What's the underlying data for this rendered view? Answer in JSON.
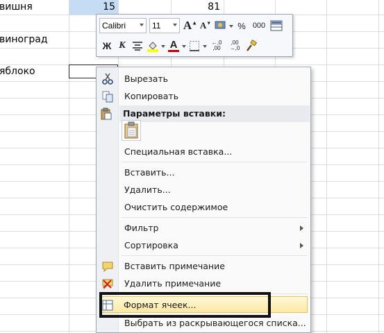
{
  "sheet": {
    "cells": [
      {
        "text": "вишня",
        "col": "A"
      },
      {
        "text": "виноград",
        "col": "A"
      },
      {
        "text": "яблоко",
        "col": "A"
      }
    ],
    "row1_b_value": "15",
    "row1_c_value": "81"
  },
  "mini_toolbar": {
    "font_name": "Calibri",
    "font_size": "11",
    "bold_label": "Ж",
    "italic_label": "К",
    "percent_label": "%",
    "thousands_label": "000",
    "dec_increase_label": "+,0\n,00",
    "dec_decrease_label": ",00\n→,0",
    "font_color": "#c00000",
    "fill_color": "#ffff00"
  },
  "context_menu": {
    "items": [
      {
        "label": "Вырезать",
        "icon": "scissors-icon"
      },
      {
        "label": "Копировать",
        "icon": "copy-icon"
      },
      {
        "label": "Параметры вставки:",
        "icon": "paste-options-icon"
      },
      {
        "label": "Специальная вставка...",
        "icon": ""
      },
      {
        "label": "Вставить...",
        "icon": ""
      },
      {
        "label": "Удалить...",
        "icon": ""
      },
      {
        "label": "Очистить содержимое",
        "icon": ""
      },
      {
        "label": "Фильтр",
        "icon": "",
        "submenu": true
      },
      {
        "label": "Сортировка",
        "icon": "",
        "submenu": true
      },
      {
        "label": "Вставить примечание",
        "icon": "insert-comment-icon"
      },
      {
        "label": "Удалить примечание",
        "icon": "delete-comment-icon"
      },
      {
        "label": "Формат ячеек...",
        "icon": "format-cells-icon"
      },
      {
        "label": "Выбрать из раскрывающегося списка...",
        "icon": ""
      }
    ]
  },
  "colors": {
    "selected_cell": "#c6dcf4",
    "menu_highlight": "#fde9a4",
    "outline": "#111111"
  }
}
